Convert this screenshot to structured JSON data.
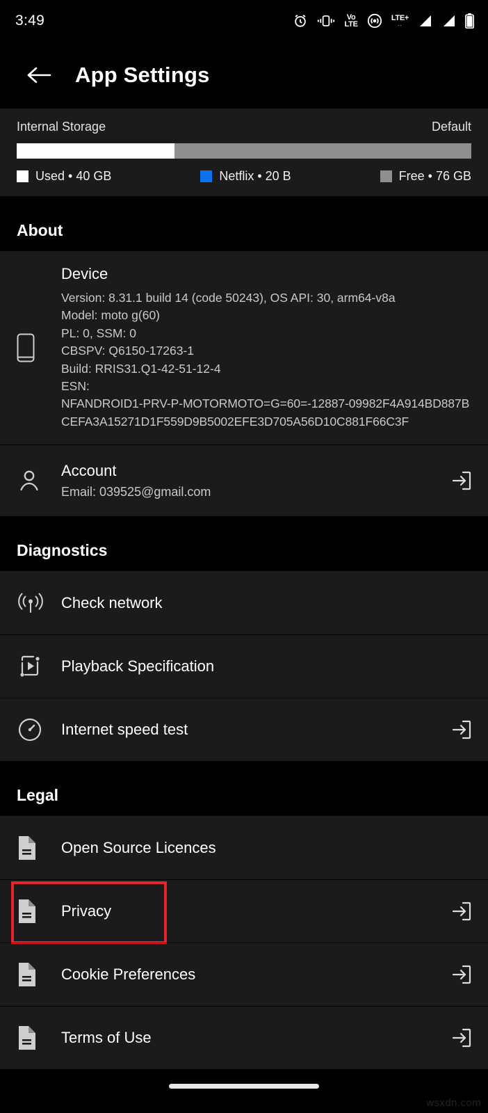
{
  "status_bar": {
    "time": "3:49",
    "icons": [
      "alarm-icon",
      "vibrate-icon",
      "volte-icon",
      "hotspot-icon",
      "lte-plus-icon",
      "signal-sim1-icon",
      "signal-sim2-icon",
      "battery-icon"
    ],
    "volte_top": "Vo",
    "volte_bottom": "LTE",
    "lte_label": "LTE+",
    "lte_sub": ".."
  },
  "app_bar": {
    "back_icon": "arrow-back-icon",
    "title": "App Settings"
  },
  "storage": {
    "label": "Internal Storage",
    "value": "Default",
    "bar": {
      "used_pct": 34.7,
      "app_pct": 0.0,
      "free_pct": 65.3,
      "used_color": "#ffffff",
      "app_color": "#0b72ef",
      "free_color": "#8f8f8f"
    },
    "legend": [
      {
        "label": "Used • 40 GB",
        "color": "#ffffff",
        "name": "legend-used"
      },
      {
        "label": "Netflix • 20 B",
        "color": "#0b72ef",
        "name": "legend-netflix"
      },
      {
        "label": "Free • 76 GB",
        "color": "#8f8f8f",
        "name": "legend-free"
      }
    ]
  },
  "sections": {
    "about": {
      "heading": "About",
      "device": {
        "icon": "phone-icon",
        "title": "Device",
        "version": "Version: 8.31.1 build 14 (code 50243), OS API: 30, arm64-v8a",
        "model": "Model: moto g(60)",
        "pl_ssm": "PL: 0, SSM: 0",
        "cbspv": "CBSPV: Q6150-17263-1",
        "build": "Build: RRIS31.Q1-42-51-12-4",
        "esn_label": "ESN:",
        "esn_value": "NFANDROID1-PRV-P-MOTORMOTO=G=60=-12887-09982F4A914BD887BCEFA3A15271D1F559D9B5002EFE3D705A56D10C881F66C3F"
      },
      "account": {
        "icon": "person-icon",
        "title": "Account",
        "email": "Email: 039525@gmail.com",
        "trail_icon": "open-external-icon"
      }
    },
    "diagnostics": {
      "heading": "Diagnostics",
      "items": [
        {
          "label": "Check network",
          "icon": "broadcast-icon",
          "trail": false
        },
        {
          "label": "Playback Specification",
          "icon": "playback-icon",
          "trail": false
        },
        {
          "label": "Internet speed test",
          "icon": "speedometer-icon",
          "trail": true
        }
      ]
    },
    "legal": {
      "heading": "Legal",
      "items": [
        {
          "label": "Open Source Licences",
          "icon": "document-icon",
          "trail": false,
          "highlighted": false
        },
        {
          "label": "Privacy",
          "icon": "document-icon",
          "trail": true,
          "highlighted": true
        },
        {
          "label": "Cookie Preferences",
          "icon": "document-icon",
          "trail": true,
          "highlighted": false
        },
        {
          "label": "Terms of Use",
          "icon": "document-icon",
          "trail": true,
          "highlighted": false
        }
      ]
    }
  },
  "nav_bar": {
    "handle": "home-gesture-handle"
  },
  "watermark": "wsxdn.com",
  "colors": {
    "background": "#000000",
    "row_background": "#1b1b1b",
    "accent_highlight": "#e8232a",
    "secondary_text": "#c9c9c9",
    "netflix_blue": "#0b72ef"
  }
}
